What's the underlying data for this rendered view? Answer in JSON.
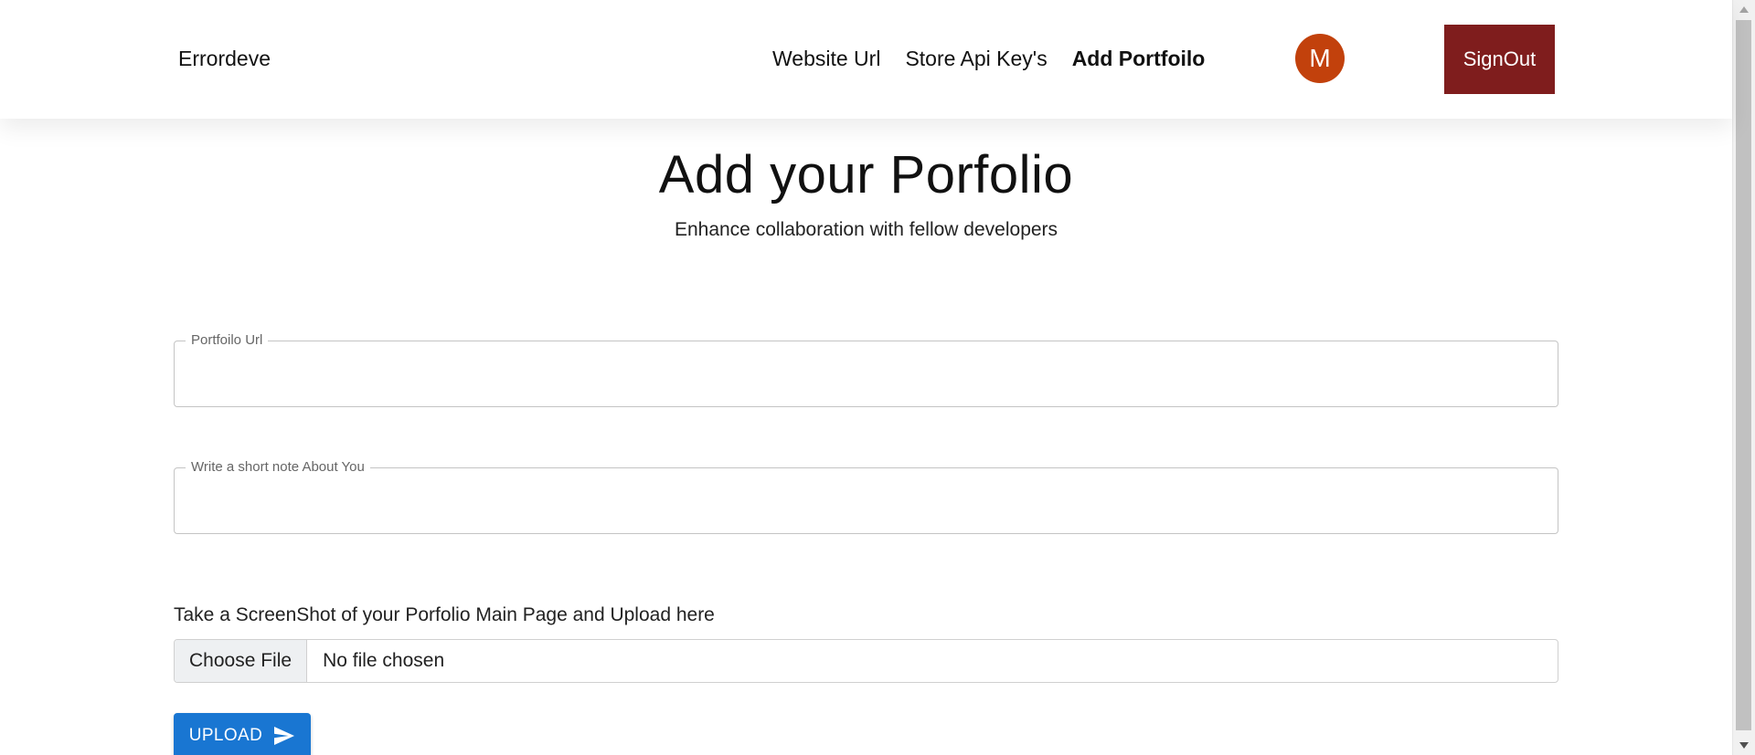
{
  "navbar": {
    "brand": "Errordeve",
    "links": [
      {
        "label": "Website Url",
        "active": false
      },
      {
        "label": "Store Api Key's",
        "active": false
      },
      {
        "label": "Add Portfoilo",
        "active": true
      }
    ],
    "avatar_initial": "M",
    "avatar_color": "#c2410c",
    "signout_label": "SignOut",
    "signout_color": "#7f1d1d"
  },
  "header": {
    "title": "Add your Porfolio",
    "subtitle": "Enhance collaboration with fellow developers"
  },
  "form": {
    "portfolio_url": {
      "label": "Portfoilo Url",
      "value": ""
    },
    "about_note": {
      "label": "Write a short note About You",
      "value": ""
    },
    "upload_instructions": "Take a ScreenShot of your Porfolio Main Page and Upload here",
    "file_button_label": "Choose File",
    "file_status": "No file chosen",
    "upload_button_label": "UPLOAD",
    "upload_button_color": "#1976d2",
    "upload_icon": "send-icon"
  }
}
